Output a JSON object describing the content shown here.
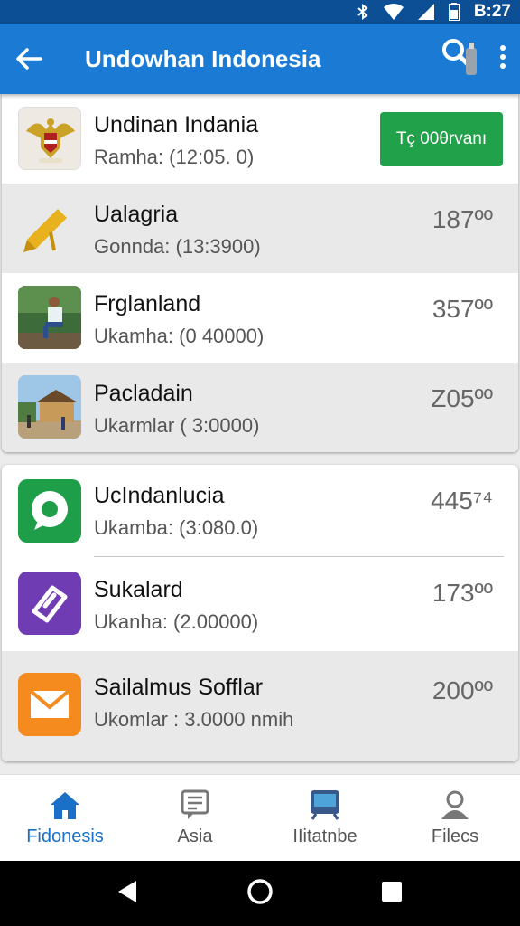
{
  "status_bar": {
    "time": "B:27"
  },
  "app_bar": {
    "title": "Undowhan Indonesia"
  },
  "card1": {
    "items": [
      {
        "title": "Undinan Indania",
        "subtitle": "Ramha: (12:05. 0)",
        "action": "Tç 00θrvanı",
        "icon": "garuda-emblem-icon"
      },
      {
        "title": "Ualagria",
        "subtitle": "Gonnda: (13:3900)",
        "value": "187ºº",
        "icon": "pen-icon"
      },
      {
        "title": "Frglanland",
        "subtitle": "Ukamha: (0 40000)",
        "value": "357ºº",
        "icon": "person-photo"
      },
      {
        "title": "Pacladain",
        "subtitle": "Ukarmlar ( 3:0000)",
        "value": "Z05ºº",
        "icon": "village-photo"
      }
    ]
  },
  "card2": {
    "items": [
      {
        "title": "UcIndanlucia",
        "subtitle": "Ukamba: (3:080.0)",
        "value": "445⁷⁴",
        "icon": "chat-bubble-icon"
      },
      {
        "title": "Sukalard",
        "subtitle": "Ukanha: (2.00000)",
        "value": "173ºº",
        "icon": "tag-icon"
      },
      {
        "title": "Sailalmus Sofflar",
        "subtitle": "Ukomlar : 3.0000 nmih",
        "value": "200ºº",
        "icon": "mail-icon"
      }
    ]
  },
  "bottom_nav": [
    {
      "label": "Fidonesis",
      "icon": "home-icon",
      "active": true
    },
    {
      "label": "Asia",
      "icon": "message-icon",
      "active": false
    },
    {
      "label": "IIitatnbe",
      "icon": "train-icon",
      "active": false
    },
    {
      "label": "Filecs",
      "icon": "person-icon",
      "active": false
    }
  ],
  "colors": {
    "app_bar": "#1a7ad4",
    "status_bar": "#0c4f95",
    "accent_green": "#21a14a",
    "nav_active": "#1a6fc7"
  }
}
